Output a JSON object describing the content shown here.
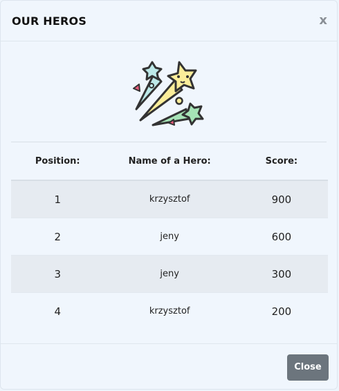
{
  "modal": {
    "title": "OUR HEROS",
    "close_symbol": "x"
  },
  "image": {
    "icon": "fireworks-confetti-icon",
    "colors": [
      "#fbee9a",
      "#bde9e8",
      "#a6e3b6",
      "#e85a7a",
      "#333333"
    ]
  },
  "table": {
    "headers": [
      "Position:",
      "Name of a Hero:",
      "Score:"
    ],
    "rows": [
      {
        "position": "1",
        "name": "krzysztof",
        "score": "900"
      },
      {
        "position": "2",
        "name": "jeny",
        "score": "600"
      },
      {
        "position": "3",
        "name": "jeny",
        "score": "300"
      },
      {
        "position": "4",
        "name": "krzysztof",
        "score": "200"
      }
    ]
  },
  "footer": {
    "close_label": "Close",
    "close_color": "#6c757d"
  }
}
